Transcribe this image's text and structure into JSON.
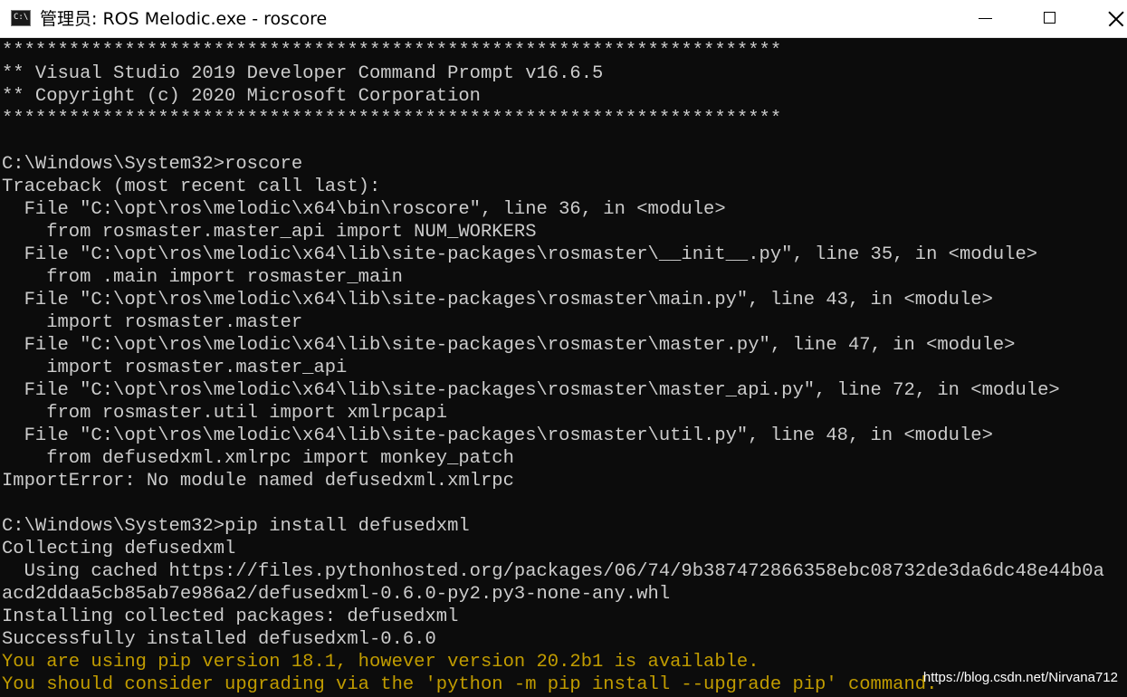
{
  "window": {
    "title": "管理员: ROS Melodic.exe - roscore",
    "icon": "cmd-icon",
    "controls": {
      "minimize": "minimize-icon",
      "maximize": "maximize-icon",
      "close": "close-icon"
    }
  },
  "colors": {
    "background": "#0c0c0c",
    "text": "#cccccc",
    "warning": "#c19c00",
    "titlebar": "#ffffff"
  },
  "console": {
    "lines": [
      {
        "text": "**********************************************************************",
        "kind": "normal"
      },
      {
        "text": "** Visual Studio 2019 Developer Command Prompt v16.6.5",
        "kind": "normal"
      },
      {
        "text": "** Copyright (c) 2020 Microsoft Corporation",
        "kind": "normal"
      },
      {
        "text": "**********************************************************************",
        "kind": "normal"
      },
      {
        "text": "",
        "kind": "normal"
      },
      {
        "text": "C:\\Windows\\System32>roscore",
        "kind": "normal"
      },
      {
        "text": "Traceback (most recent call last):",
        "kind": "normal"
      },
      {
        "text": "  File \"C:\\opt\\ros\\melodic\\x64\\bin\\roscore\", line 36, in <module>",
        "kind": "normal"
      },
      {
        "text": "    from rosmaster.master_api import NUM_WORKERS",
        "kind": "normal"
      },
      {
        "text": "  File \"C:\\opt\\ros\\melodic\\x64\\lib\\site-packages\\rosmaster\\__init__.py\", line 35, in <module>",
        "kind": "normal"
      },
      {
        "text": "    from .main import rosmaster_main",
        "kind": "normal"
      },
      {
        "text": "  File \"C:\\opt\\ros\\melodic\\x64\\lib\\site-packages\\rosmaster\\main.py\", line 43, in <module>",
        "kind": "normal"
      },
      {
        "text": "    import rosmaster.master",
        "kind": "normal"
      },
      {
        "text": "  File \"C:\\opt\\ros\\melodic\\x64\\lib\\site-packages\\rosmaster\\master.py\", line 47, in <module>",
        "kind": "normal"
      },
      {
        "text": "    import rosmaster.master_api",
        "kind": "normal"
      },
      {
        "text": "  File \"C:\\opt\\ros\\melodic\\x64\\lib\\site-packages\\rosmaster\\master_api.py\", line 72, in <module>",
        "kind": "normal"
      },
      {
        "text": "    from rosmaster.util import xmlrpcapi",
        "kind": "normal"
      },
      {
        "text": "  File \"C:\\opt\\ros\\melodic\\x64\\lib\\site-packages\\rosmaster\\util.py\", line 48, in <module>",
        "kind": "normal"
      },
      {
        "text": "    from defusedxml.xmlrpc import monkey_patch",
        "kind": "normal"
      },
      {
        "text": "ImportError: No module named defusedxml.xmlrpc",
        "kind": "normal"
      },
      {
        "text": "",
        "kind": "normal"
      },
      {
        "text": "C:\\Windows\\System32>pip install defusedxml",
        "kind": "normal"
      },
      {
        "text": "Collecting defusedxml",
        "kind": "normal"
      },
      {
        "text": "  Using cached https://files.pythonhosted.org/packages/06/74/9b387472866358ebc08732de3da6dc48e44b0a",
        "kind": "normal"
      },
      {
        "text": "acd2ddaa5cb85ab7e986a2/defusedxml-0.6.0-py2.py3-none-any.whl",
        "kind": "normal"
      },
      {
        "text": "Installing collected packages: defusedxml",
        "kind": "normal"
      },
      {
        "text": "Successfully installed defusedxml-0.6.0",
        "kind": "normal"
      },
      {
        "text": "You are using pip version 18.1, however version 20.2b1 is available.",
        "kind": "warn"
      },
      {
        "text": "You should consider upgrading via the 'python -m pip install --upgrade pip' command.",
        "kind": "warn"
      }
    ]
  },
  "watermark": "https://blog.csdn.net/Nirvana712"
}
